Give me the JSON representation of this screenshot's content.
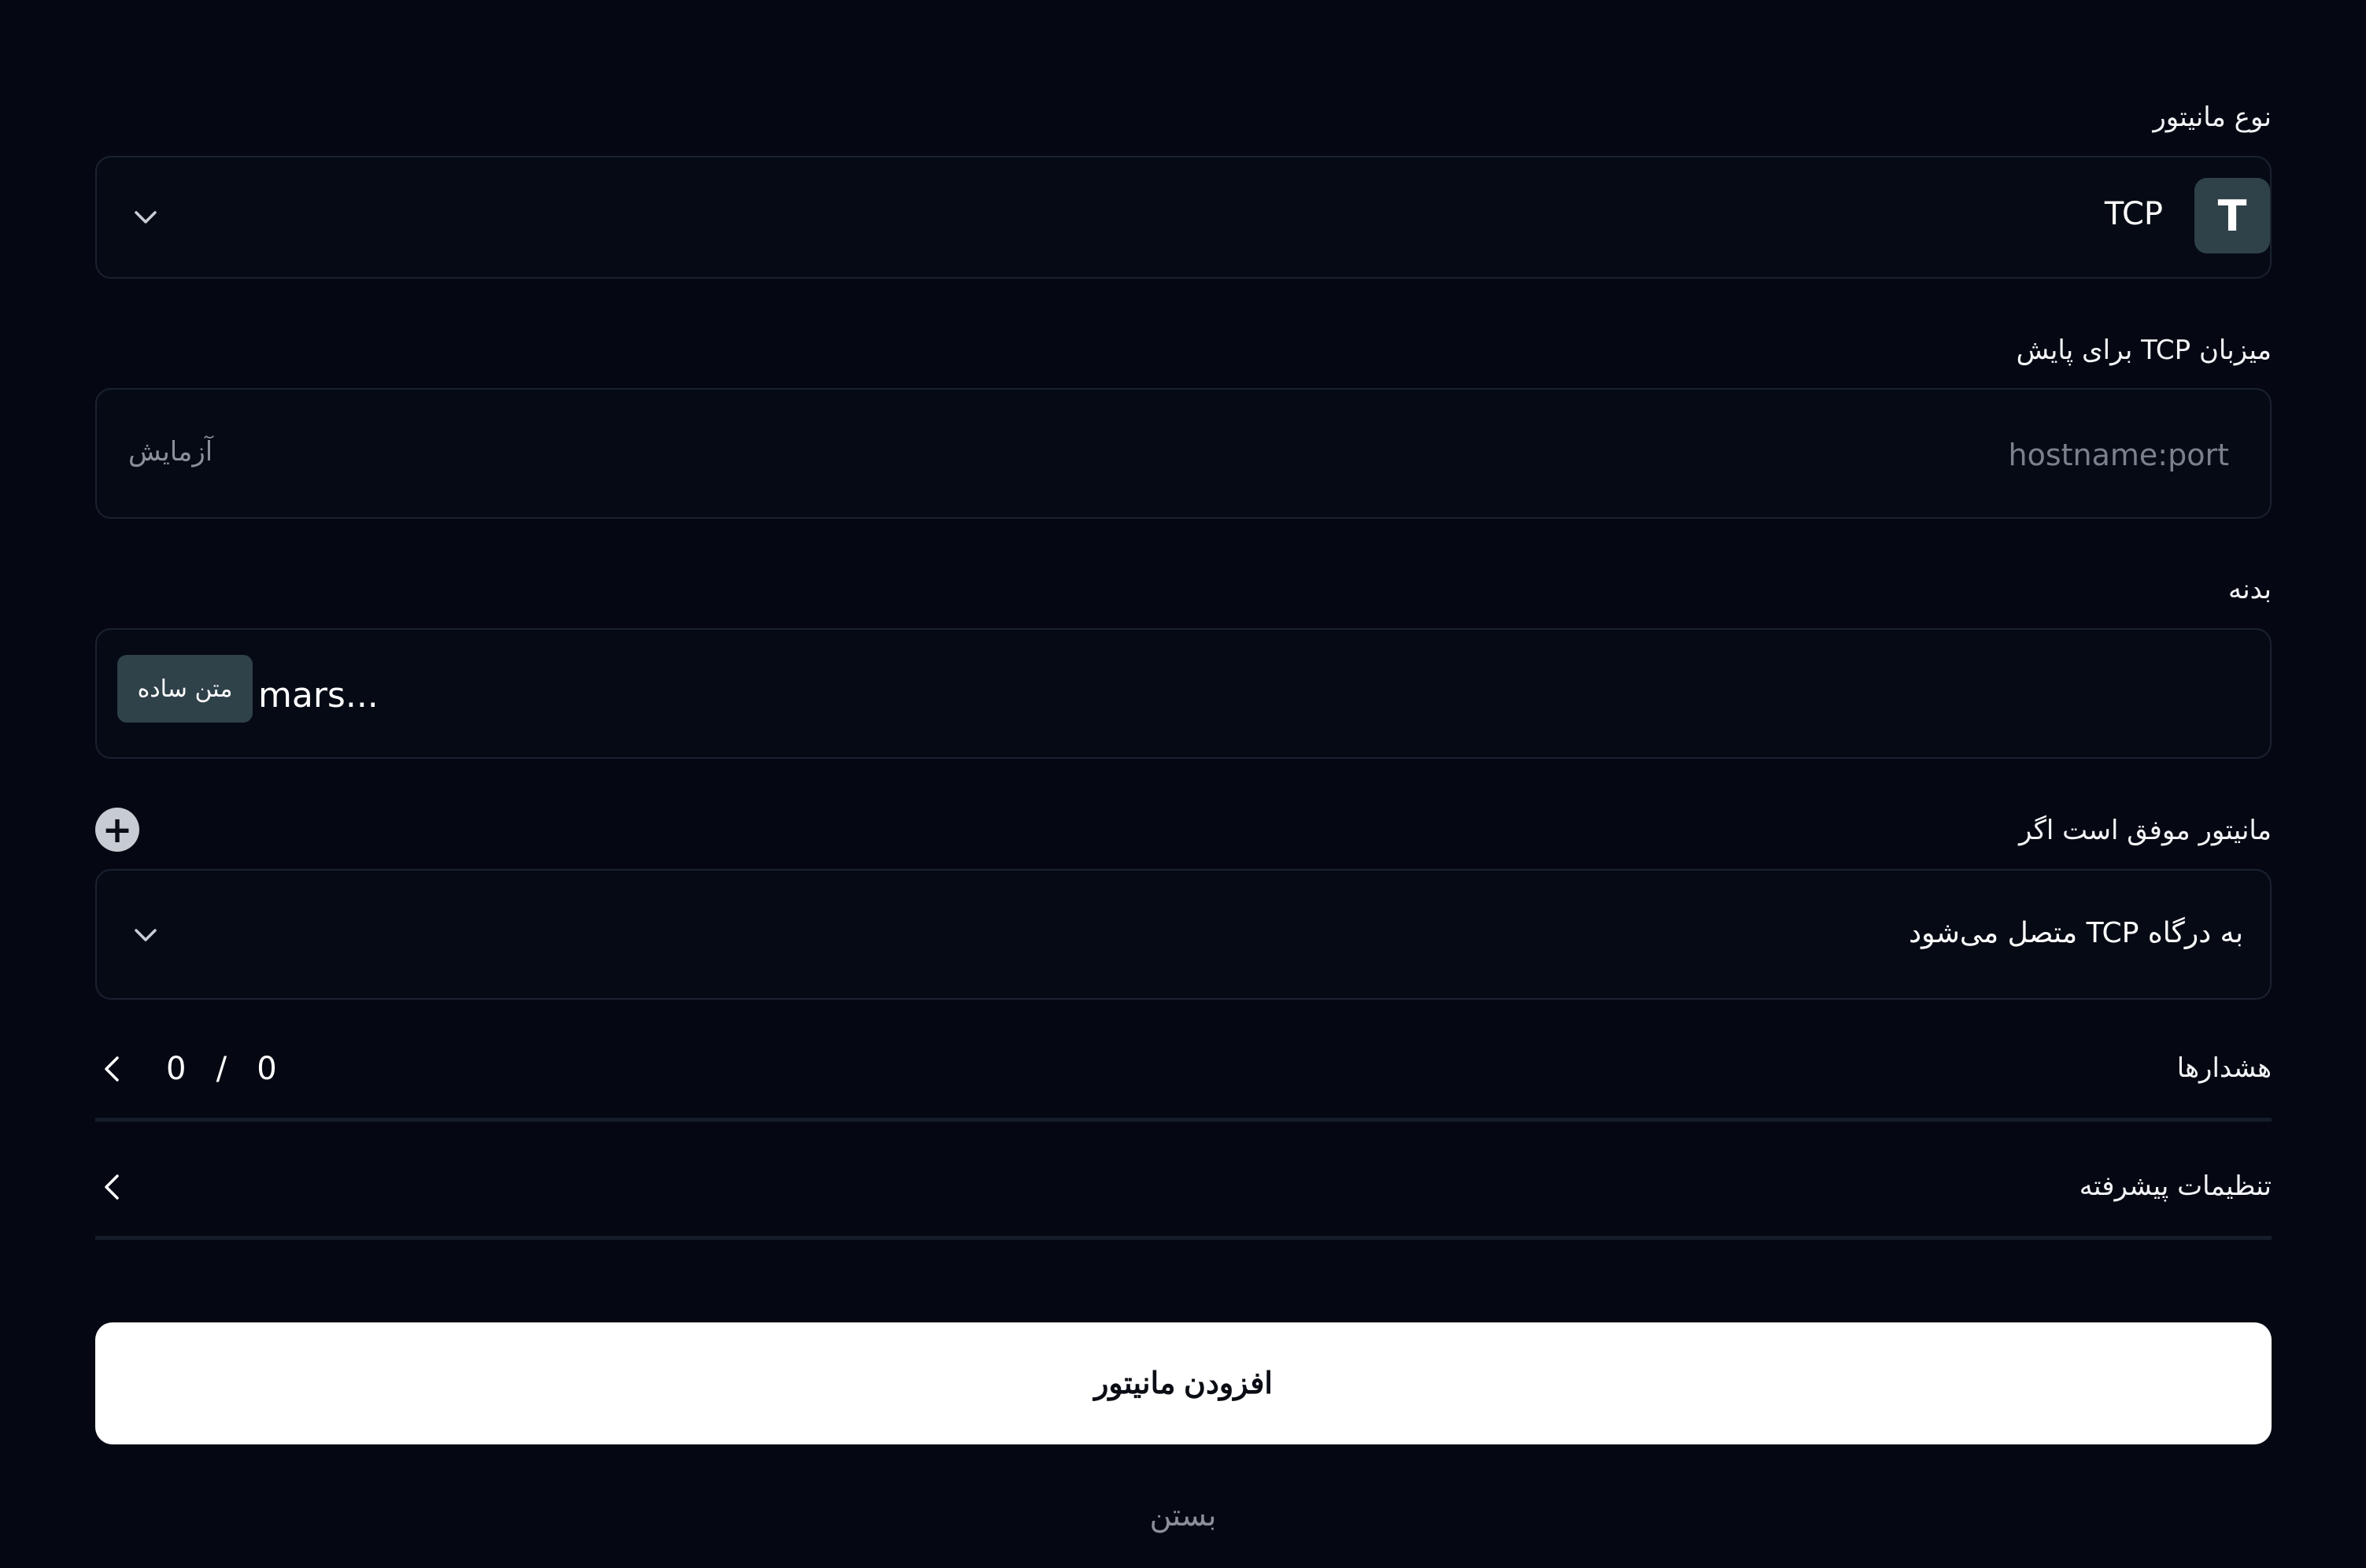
{
  "monitor_type": {
    "label": "نوع مانیتور",
    "icon_letter": "T",
    "value": "TCP"
  },
  "host": {
    "label": "میزبان TCP برای پایش",
    "placeholder": "hostname:port",
    "suffix": "آزمایش"
  },
  "body": {
    "label": "بدنه",
    "value": "mars...",
    "format_badge": "متن ساده"
  },
  "success_condition": {
    "label": "مانیتور موفق است اگر",
    "value": "به درگاه TCP متصل می‌شود"
  },
  "alerts": {
    "label": "هشدارها",
    "count": "0",
    "separator": "/",
    "total": "0"
  },
  "advanced": {
    "label": "تنظیمات پیشرفته"
  },
  "actions": {
    "submit_label": "افزودن مانیتور",
    "close_label": "بستن"
  },
  "colors": {
    "background": "#050812",
    "field_border": "#1a2130",
    "badge_bg": "#2f4149",
    "primary_button": "#ffffff"
  }
}
